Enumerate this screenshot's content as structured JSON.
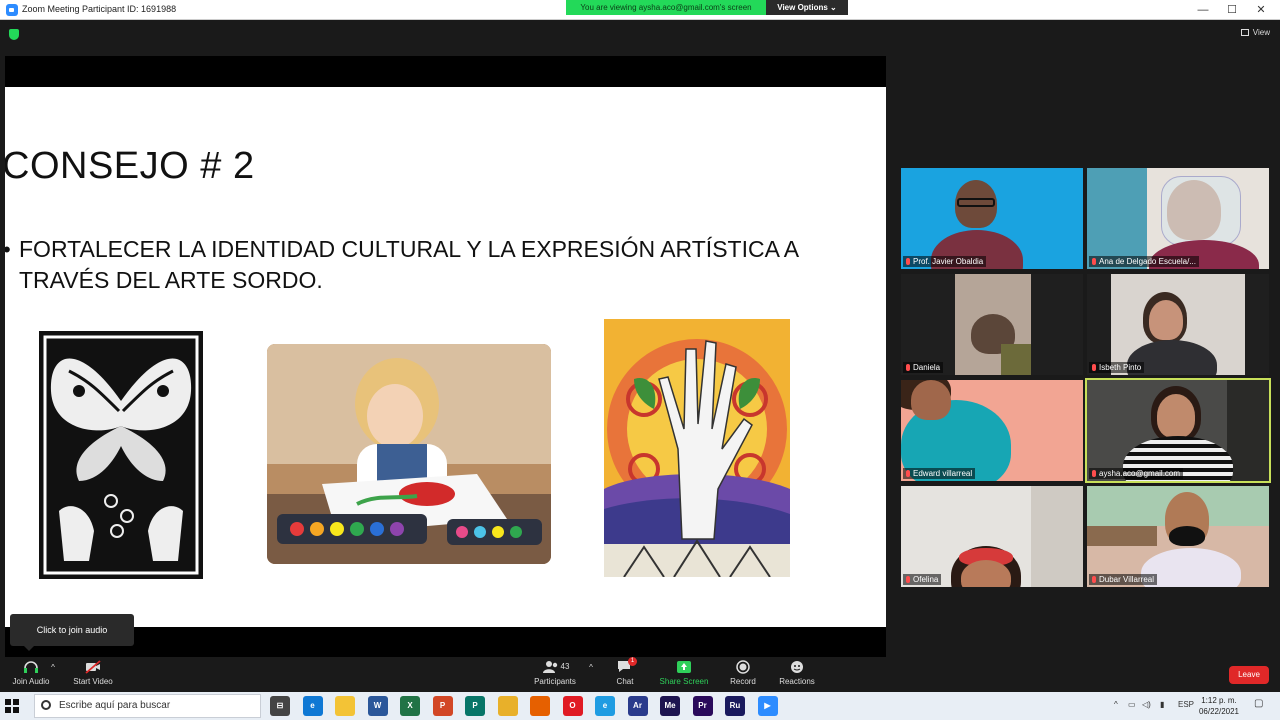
{
  "window": {
    "title": "Zoom Meeting Participant ID: 1691988",
    "minimize": "—",
    "maximize": "☐",
    "close": "✕"
  },
  "banner": {
    "viewing": "You are viewing aysha.aco@gmail.com's screen",
    "view_options": "View Options ⌄"
  },
  "top_right": {
    "view_label": "View"
  },
  "slide": {
    "title": "CONSEJO # 2",
    "bullet": "FORTALECER LA IDENTIDAD CULTURAL Y LA EXPRESIÓN ARTÍSTICA A TRAVÉS DEL ARTE SORDO."
  },
  "participants": [
    {
      "name": "Prof. Javier Obaldia",
      "bg": "#1aa3e0"
    },
    {
      "name": "Ana de Delgado Escuela/...",
      "bg": "#5aa7b8"
    },
    {
      "name": "Daniela",
      "bg": "#8c7a6b"
    },
    {
      "name": "Isbeth Pinto",
      "bg": "#d9d4cf"
    },
    {
      "name": "Edward villarreal",
      "bg": "#f2a593"
    },
    {
      "name": "aysha.aco@gmail.com",
      "bg": "#4a4a48"
    },
    {
      "name": "Ofelina",
      "bg": "#e5e3df"
    },
    {
      "name": "Dubar Villarreal",
      "bg": "#d7b8a6"
    }
  ],
  "tooltip": "Click to join audio",
  "toolbar": {
    "join_audio": "Join Audio",
    "start_video": "Start Video",
    "participants": "Participants",
    "participants_count": "43",
    "chat": "Chat",
    "chat_badge": "1",
    "share_screen": "Share Screen",
    "record": "Record",
    "reactions": "Reactions",
    "leave": "Leave"
  },
  "taskbar": {
    "search_placeholder": "Escribe aquí para buscar",
    "apps": [
      {
        "icon": "task-view-icon",
        "label": "⊟",
        "color": "#444"
      },
      {
        "icon": "edge-icon",
        "label": "e",
        "color": "#0f78d4"
      },
      {
        "icon": "folder-icon",
        "label": "",
        "color": "#f3c336"
      },
      {
        "icon": "word-icon",
        "label": "W",
        "color": "#2b579a"
      },
      {
        "icon": "excel-icon",
        "label": "X",
        "color": "#217346"
      },
      {
        "icon": "powerpoint-icon",
        "label": "P",
        "color": "#d24726"
      },
      {
        "icon": "publisher-icon",
        "label": "P",
        "color": "#077568"
      },
      {
        "icon": "chrome-icon",
        "label": "",
        "color": "#e8b02a"
      },
      {
        "icon": "firefox-icon",
        "label": "",
        "color": "#e66000"
      },
      {
        "icon": "opera-icon",
        "label": "O",
        "color": "#e01b24"
      },
      {
        "icon": "ie-icon",
        "label": "e",
        "color": "#1f9ce2"
      },
      {
        "icon": "adobe-reader-icon",
        "label": "Ar",
        "color": "#2a3b8c"
      },
      {
        "icon": "media-encoder-icon",
        "label": "Me",
        "color": "#1d1450"
      },
      {
        "icon": "premiere-icon",
        "label": "Pr",
        "color": "#2a0a5b"
      },
      {
        "icon": "rush-icon",
        "label": "Ru",
        "color": "#1a1a5e"
      },
      {
        "icon": "zoom-app-icon",
        "label": "▶",
        "color": "#2d8cff"
      }
    ],
    "lang": "ESP",
    "time": "1:12 p. m.",
    "date": "06/22/2021"
  }
}
